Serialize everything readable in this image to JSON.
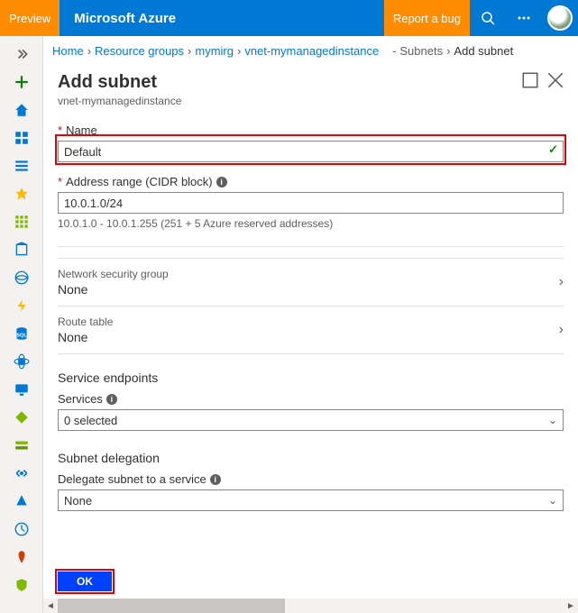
{
  "topbar": {
    "preview": "Preview",
    "brand": "Microsoft Azure",
    "report": "Report a bug"
  },
  "breadcrumbs": {
    "home": "Home",
    "rg": "Resource groups",
    "rgname": "mymirg",
    "vnet": "vnet-mymanagedinstance",
    "subnets": "- Subnets",
    "add": "Add subnet"
  },
  "panel": {
    "title": "Add subnet",
    "subtitle": "vnet-mymanagedinstance"
  },
  "name": {
    "label": "Name",
    "value": "Default"
  },
  "cidr": {
    "label": "Address range (CIDR block)",
    "value": "10.0.1.0/24",
    "helper": "10.0.1.0 - 10.0.1.255 (251 + 5 Azure reserved addresses)"
  },
  "nsg": {
    "label": "Network security group",
    "value": "None"
  },
  "rt": {
    "label": "Route table",
    "value": "None"
  },
  "endpoints": {
    "title": "Service endpoints",
    "services_label": "Services",
    "services_value": "0 selected"
  },
  "delegation": {
    "title": "Subnet delegation",
    "label": "Delegate subnet to a service",
    "value": "None"
  },
  "footer": {
    "ok": "OK"
  }
}
